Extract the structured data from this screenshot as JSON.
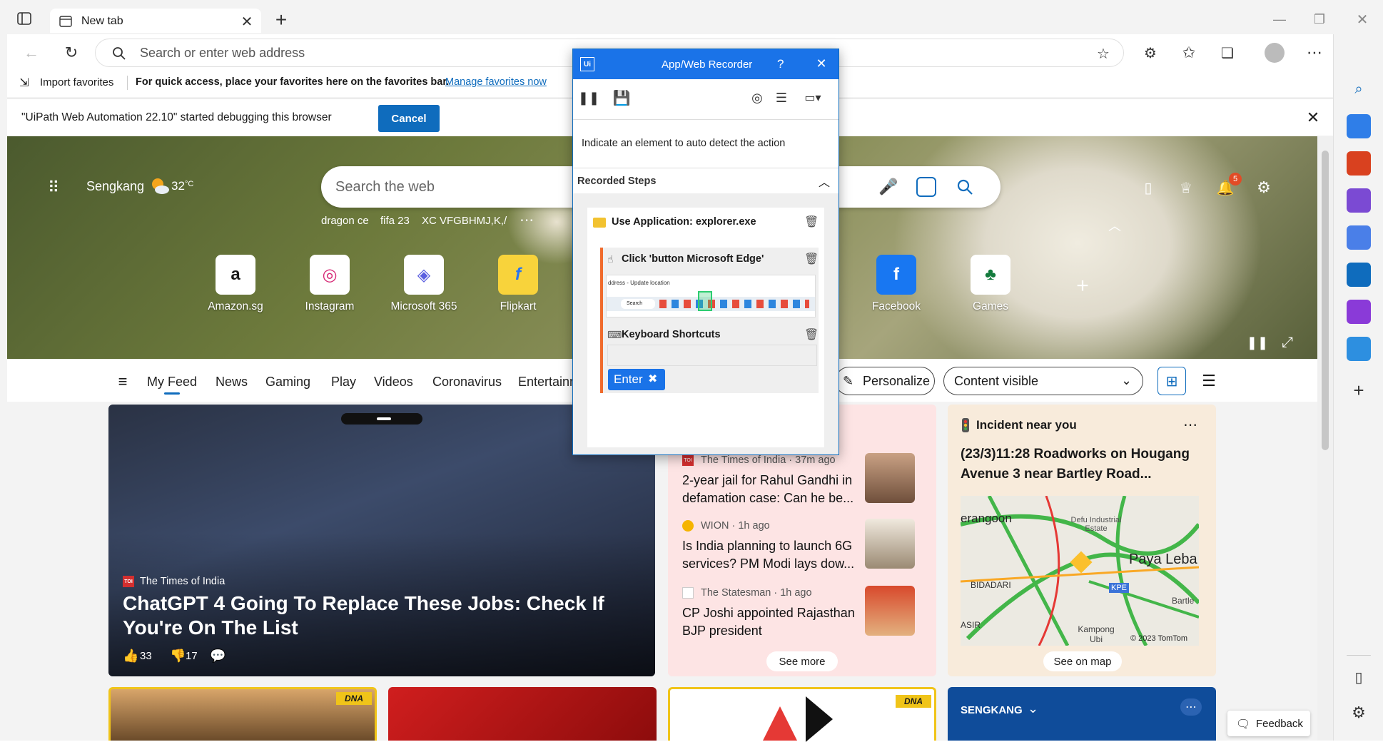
{
  "browser": {
    "tab_title": "New tab",
    "address_placeholder": "Search or enter web address",
    "favorites": {
      "import_label": "Import favorites",
      "message": "For quick access, place your favorites here on the favorites bar.",
      "manage_link": "Manage favorites now"
    },
    "infobar": {
      "message": "\"UiPath Web Automation 22.10\" started debugging this browser",
      "cancel_label": "Cancel"
    },
    "notification_count": "5"
  },
  "hero": {
    "location": "Sengkang",
    "temperature": "32",
    "temp_unit": "°C",
    "search_placeholder": "Search the web",
    "quick_searches": [
      "dragon ce",
      "fifa 23",
      "XC VFGBHMJ,K,/"
    ],
    "tiles": [
      {
        "label": "Amazon.sg",
        "glyph": "a"
      },
      {
        "label": "Instagram",
        "glyph": "◎"
      },
      {
        "label": "Microsoft 365",
        "glyph": "◈"
      },
      {
        "label": "Flipkart",
        "glyph": "f"
      },
      {
        "label": "Facebook",
        "glyph": "f"
      },
      {
        "label": "Games",
        "glyph": "♣"
      }
    ]
  },
  "feed": {
    "tabs": [
      "My Feed",
      "News",
      "Gaming",
      "Play",
      "Videos",
      "Coronavirus",
      "Entertainm"
    ],
    "personalize_label": "Personalize",
    "content_visible_label": "Content visible",
    "main_card": {
      "source": "The Times of India",
      "headline": "ChatGPT 4 Going To Replace These Jobs: Check If You're On The List",
      "likes": "33",
      "dislikes": "17"
    },
    "news": [
      {
        "source": "The Times of India · 37m ago",
        "headline": "2-year jail for Rahul Gandhi in defamation case: Can he be..."
      },
      {
        "source": "WION · 1h ago",
        "headline": "Is India planning to launch 6G services? PM Modi lays dow..."
      },
      {
        "source": "The Statesman · 1h ago",
        "headline": "CP Joshi appointed Rajasthan BJP president"
      }
    ],
    "see_more_label": "See more",
    "incident": {
      "title": "Incident near you",
      "description": "(23/3)11:28 Roadworks on Hougang Avenue 3 near Bartley Road...",
      "map_labels": [
        "erangoon",
        "Defu Industrial Estate",
        "Paya Leba",
        "BIDADARI",
        "KPE",
        "Bartle",
        "ASIR",
        "Kampong Ubi",
        "© 2023 TomTom"
      ],
      "see_on_map_label": "See on map"
    },
    "bottom": {
      "badge": "DNA",
      "location_label": "SENGKANG"
    },
    "feedback_label": "Feedback"
  },
  "recorder": {
    "title": "App/Web Recorder",
    "help": "?",
    "instruction": "Indicate an element to auto detect the action",
    "recorded_steps_label": "Recorded Steps",
    "steps": [
      {
        "label": "Use Application: explorer.exe"
      },
      {
        "label": "Click 'button Microsoft Edge'"
      },
      {
        "label": "Keyboard Shortcuts"
      }
    ],
    "key_label": "Enter",
    "mini_search": "Search",
    "mini_location": "ddress - Update location"
  },
  "colors": {
    "accent": "#0f6cbd",
    "recorder_title": "#1a73e8",
    "step_marker": "#f06b2c",
    "badge": "#f0c419"
  }
}
